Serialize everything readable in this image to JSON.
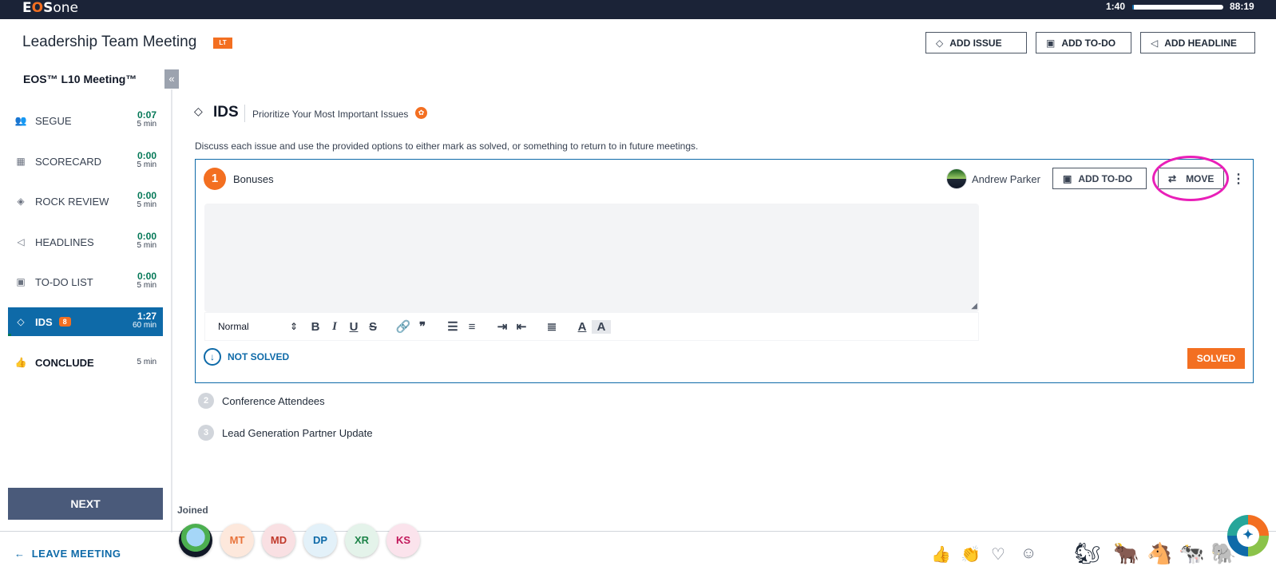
{
  "app": {
    "logo_prefix": "E",
    "logo_o": "O",
    "logo_s": "S",
    "logo_suffix": "one"
  },
  "timer": {
    "elapsed": "1:40",
    "total": "88:19",
    "progress": 0.02
  },
  "header": {
    "title": "Leadership Team Meeting",
    "badge": "LT",
    "buttons": [
      {
        "label": "ADD ISSUE",
        "icon": "diamond-icon"
      },
      {
        "label": "ADD TO-DO",
        "icon": "calendar-check-icon"
      },
      {
        "label": "ADD HEADLINE",
        "icon": "megaphone-icon"
      }
    ]
  },
  "sidebar": {
    "title": "EOS™ L10 Meeting™",
    "collapse_icon": "«",
    "items": [
      {
        "label": "SEGUE",
        "icon": "users-icon",
        "time": "0:07",
        "duration": "5 min"
      },
      {
        "label": "SCORECARD",
        "icon": "chart-icon",
        "time": "0:00",
        "duration": "5 min"
      },
      {
        "label": "ROCK REVIEW",
        "icon": "gem-icon",
        "time": "0:00",
        "duration": "5 min"
      },
      {
        "label": "HEADLINES",
        "icon": "megaphone-icon",
        "time": "0:00",
        "duration": "5 min"
      },
      {
        "label": "TO-DO LIST",
        "icon": "calendar-check-icon",
        "time": "0:00",
        "duration": "5 min"
      },
      {
        "label": "IDS",
        "icon": "diamond-icon",
        "badge": "8",
        "time": "1:27",
        "duration": "60 min",
        "active": true
      },
      {
        "label": "CONCLUDE",
        "icon": "thumbs-up-icon",
        "time": "",
        "duration": "5 min"
      }
    ],
    "next_label": "NEXT",
    "leave_label": "LEAVE MEETING"
  },
  "section": {
    "title": "IDS",
    "subtitle": "Prioritize Your Most Important Issues",
    "description": "Discuss each issue and use the provided options to either mark as solved, or something to return to in future meetings."
  },
  "active_issue": {
    "number": "1",
    "title": "Bonuses",
    "owner": "Andrew Parker",
    "add_todo_label": "ADD TO-DO",
    "move_label": "MOVE",
    "editor": {
      "style_select": "Normal",
      "tools": [
        "B",
        "I",
        "U",
        "S"
      ]
    },
    "not_solved_label": "NOT SOLVED",
    "solved_label": "SOLVED"
  },
  "other_issues": [
    {
      "number": "2",
      "title": "Conference Attendees"
    },
    {
      "number": "3",
      "title": "Lead Generation Partner Update"
    }
  ],
  "attendees": {
    "label": "Joined",
    "people": [
      {
        "initials": "",
        "photo": true
      },
      {
        "initials": "MT",
        "color": "#e8733a",
        "bg": "#fde8dc"
      },
      {
        "initials": "MD",
        "color": "#c0392b",
        "bg": "#f9e0e3"
      },
      {
        "initials": "DP",
        "color": "#0e6aa8",
        "bg": "#e3f1f9"
      },
      {
        "initials": "XR",
        "color": "#1e8449",
        "bg": "#e4f3ea"
      },
      {
        "initials": "KS",
        "color": "#c2185b",
        "bg": "#fbe3ec"
      }
    ]
  },
  "reactions": [
    "thumbs-up-icon",
    "clap-icon",
    "heart-icon",
    "smile-icon"
  ],
  "animals": [
    "squirrel-icon",
    "bull-icon",
    "donkey-icon",
    "cow-icon",
    "elephant-icon"
  ],
  "colors": {
    "accent": "#0e6aa8",
    "brand_orange": "#f36f21",
    "topbar": "#1b2337",
    "highlight": "#e91fb8"
  }
}
